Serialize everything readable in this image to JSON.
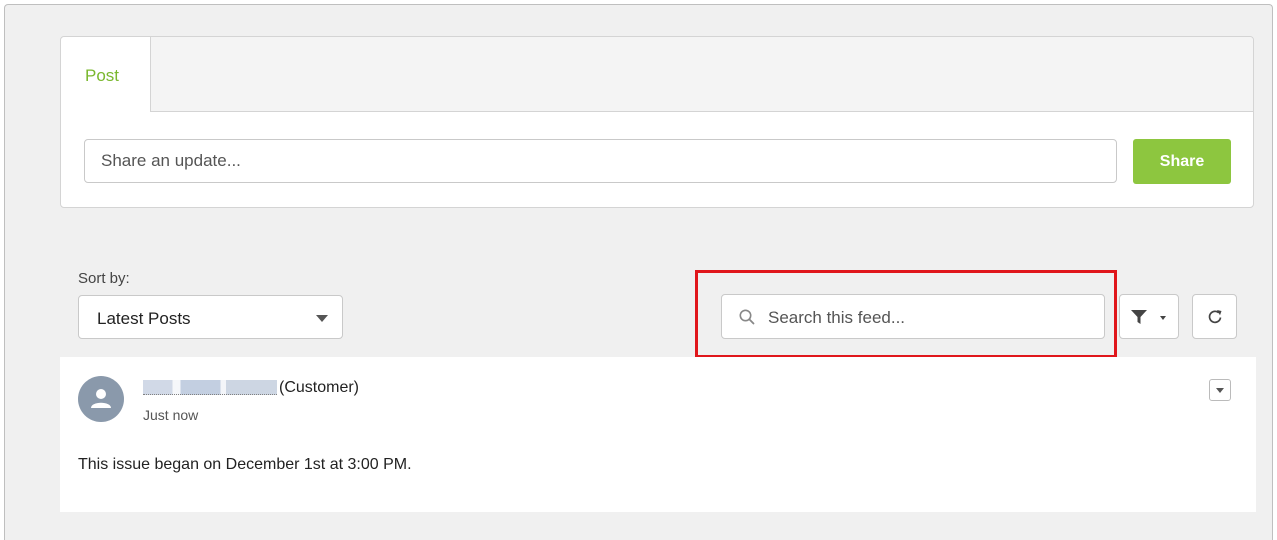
{
  "publisher": {
    "tab_post_label": "Post",
    "share_placeholder": "Share an update...",
    "share_button_label": "Share"
  },
  "feed_controls": {
    "sort_label": "Sort by:",
    "sort_selected": "Latest Posts",
    "search_placeholder": "Search this feed..."
  },
  "post": {
    "author_role": "(Customer)",
    "timestamp": "Just now",
    "body": "This issue began on December 1st at 3:00 PM."
  },
  "colors": {
    "accent_green": "#8dc63f",
    "tab_text_green": "#7ab82e",
    "highlight_red": "#e0161b"
  }
}
